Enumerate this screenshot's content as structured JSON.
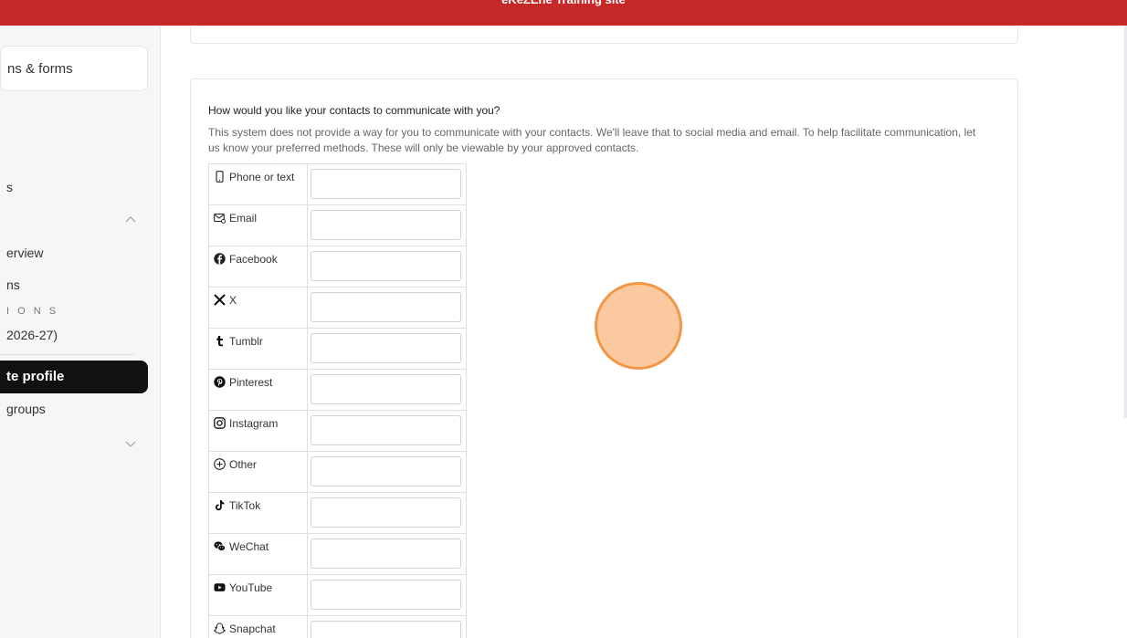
{
  "banner": {
    "title": "eKeZEne Training site"
  },
  "sidebar": {
    "card_label": "ns & forms",
    "items": [
      {
        "label": "s"
      },
      {
        "label": "erview"
      },
      {
        "label": "ns"
      },
      {
        "label": "I O N S"
      },
      {
        "label": "2026-27)"
      },
      {
        "label": "te profile"
      },
      {
        "label": "groups"
      }
    ]
  },
  "contacts": {
    "question": "How would you like your contacts to communicate with you?",
    "description": "This system does not provide a way for you to communicate with your contacts. We'll leave that to social media and email. To help facilitate communication, let us know your preferred methods. These will only be viewable by your approved contacts.",
    "methods": [
      {
        "label": "Phone or text",
        "icon": "phone-icon",
        "value": ""
      },
      {
        "label": "Email",
        "icon": "email-icon",
        "value": ""
      },
      {
        "label": "Facebook",
        "icon": "facebook-icon",
        "value": ""
      },
      {
        "label": "X",
        "icon": "x-icon",
        "value": ""
      },
      {
        "label": "Tumblr",
        "icon": "tumblr-icon",
        "value": ""
      },
      {
        "label": "Pinterest",
        "icon": "pinterest-icon",
        "value": ""
      },
      {
        "label": "Instagram",
        "icon": "instagram-icon",
        "value": ""
      },
      {
        "label": "Other",
        "icon": "plus-circle-icon",
        "value": ""
      },
      {
        "label": "TikTok",
        "icon": "tiktok-icon",
        "value": ""
      },
      {
        "label": "WeChat",
        "icon": "wechat-icon",
        "value": ""
      },
      {
        "label": "YouTube",
        "icon": "youtube-icon",
        "value": ""
      },
      {
        "label": "Snapchat",
        "icon": "snapchat-icon",
        "value": ""
      }
    ]
  },
  "colors": {
    "banner": "#c62828",
    "click_fill": "#fbc79b",
    "click_border": "#f2923c",
    "active_item": "#111111"
  }
}
